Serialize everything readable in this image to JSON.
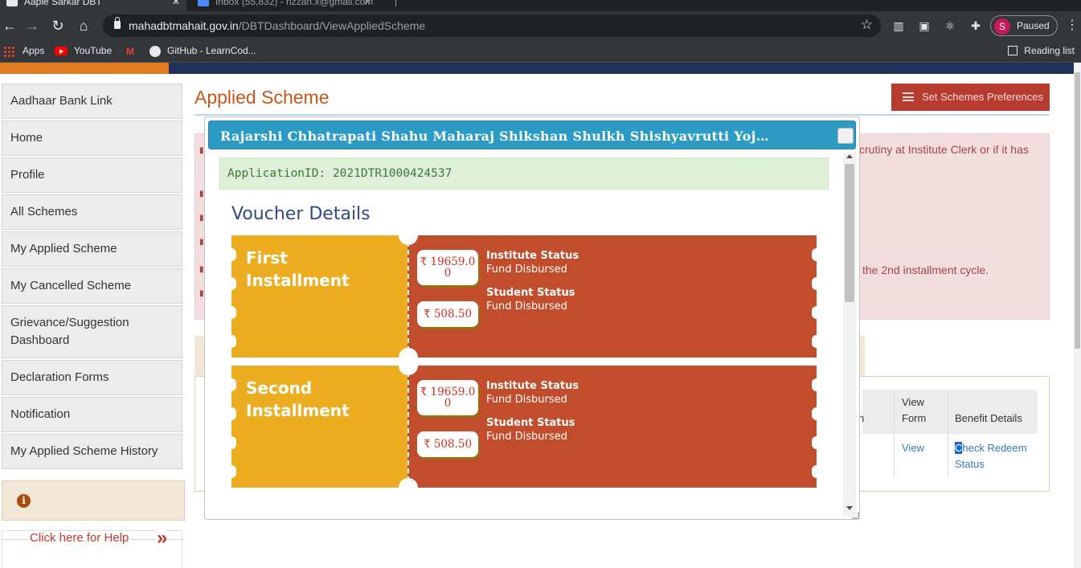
{
  "browser": {
    "tabs": [
      {
        "title": "Aaple Sarkar DBT",
        "active": true
      },
      {
        "title": "Inbox (55,832) - rizzan.x@gmail.com",
        "active": false
      }
    ],
    "url_host": "mahadbtmahait.gov.in",
    "url_path": "/DBTDashboard/ViewAppliedScheme",
    "profile_initial": "S",
    "profile_status": "Paused",
    "bookmarks": [
      "Apps",
      "YouTube",
      "GitHub - LearnCod..."
    ],
    "reading_list": "Reading list",
    "colors": {
      "chrome_dark": "#202124",
      "chrome": "#35363a",
      "profile": "#c8185b"
    }
  },
  "sidebar": {
    "items": [
      "Aadhaar Bank Link",
      "Home",
      "Profile",
      "All Schemes",
      "My Applied Scheme",
      "My Cancelled Scheme",
      "Grievance/Suggestion Dashboard",
      "Declaration Forms",
      "Notification",
      "My Applied Scheme History"
    ],
    "help_text": "Click here for Help",
    "help_icon": "chevron-double-right-icon",
    "info_icon": "info-icon"
  },
  "main": {
    "title": "Applied Scheme",
    "preferences_button": "Set Schemes Preferences",
    "alert_fragment_1": "crutiny at Institute Clerk or if it has",
    "alert_fragment_2": "the 2nd installment cycle.",
    "table_headers": [
      "n",
      "View Form",
      "Benefit Details"
    ],
    "view_link": "View",
    "check_redeem_sel": "C",
    "check_redeem_rest": "heck Redeem Status"
  },
  "modal": {
    "title": "Rajarshi Chhatrapati Shahu Maharaj Shikshan Shulkh Shishyavrutti Yojna(EBC...",
    "application_id": "ApplicationID: 2021DTR1000424537",
    "voucher_heading": "Voucher Details",
    "currency_symbol": "₹",
    "vouchers": [
      {
        "title_line1": "First",
        "title_line2": "Installment",
        "institute_amount_a": "₹ 19659.0",
        "institute_amount_b": "0",
        "student_amount": "₹ 508.50",
        "institute_status_label": "Institute Status",
        "institute_status_value": "Fund Disbursed",
        "student_status_label": "Student Status",
        "student_status_value": "Fund Disbursed"
      },
      {
        "title_line1": "Second",
        "title_line2": "Installment",
        "institute_amount_a": "₹ 19659.0",
        "institute_amount_b": "0",
        "student_amount": "₹ 508.50",
        "institute_status_label": "Institute Status",
        "institute_status_value": "Fund Disbursed",
        "student_status_label": "Student Status",
        "student_status_value": "Fund Disbursed"
      }
    ],
    "colors": {
      "header": "#2b9bc6",
      "voucher_left": "#ecae20",
      "voucher_right": "#c24d2c",
      "amount": "#d92c1f",
      "success_bg": "#dff0d8"
    }
  }
}
